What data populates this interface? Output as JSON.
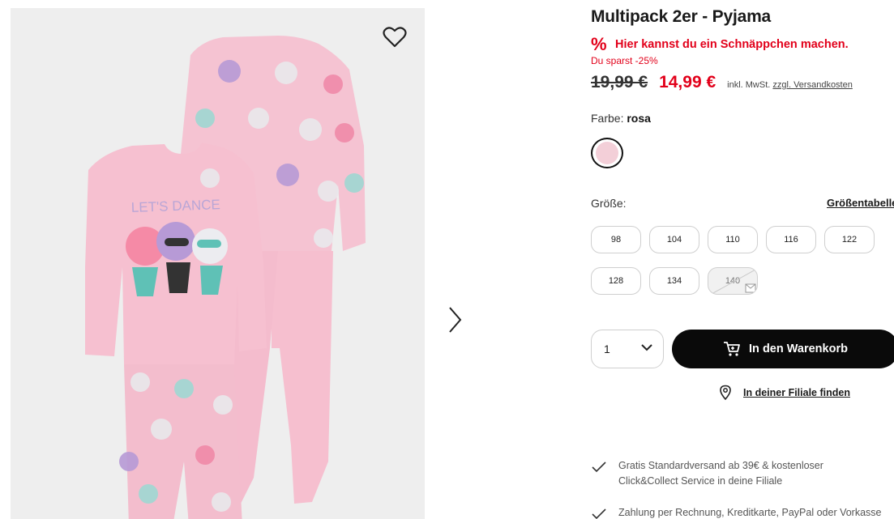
{
  "product": {
    "title": "Multipack 2er - Pyjama",
    "deal_icon": "%",
    "deal_text": "Hier kannst du ein Schnäppchen machen.",
    "savings": "Du sparst -25%",
    "old_price": "19,99 €",
    "new_price": "14,99 €",
    "vat_prefix": "inkl. MwSt.",
    "shipping_link": "zzgl. Versandkosten",
    "image_text": "LET'S DANCE"
  },
  "color": {
    "label": "Farbe:",
    "value": "rosa",
    "swatch_color": "#f3cfd8"
  },
  "size": {
    "label": "Größe:",
    "table_link": "Größentabelle",
    "options": [
      {
        "label": "98",
        "available": true
      },
      {
        "label": "104",
        "available": true
      },
      {
        "label": "110",
        "available": true
      },
      {
        "label": "116",
        "available": true
      },
      {
        "label": "122",
        "available": true
      },
      {
        "label": "128",
        "available": true
      },
      {
        "label": "134",
        "available": true
      },
      {
        "label": "140",
        "available": false
      }
    ]
  },
  "purchase": {
    "quantity": "1",
    "cart_label": "In den Warenkorb",
    "store_label": "In deiner Filiale finden"
  },
  "benefits": [
    {
      "line1": "Gratis Standardversand ab 39€ & kostenloser",
      "line2": "Click&Collect Service in deine Filiale"
    },
    {
      "line1": "Zahlung per Rechnung, Kreditkarte, PayPal oder Vorkasse",
      "line2": ""
    }
  ],
  "icons": {
    "favorite": "heart-icon",
    "next": "chevron-right-icon",
    "cart": "cart-icon",
    "store": "location-pin-icon",
    "check": "check-icon"
  },
  "colors": {
    "accent": "#e2001a",
    "button": "#0a0a0a",
    "pyjama_pink": "#f6c4d2",
    "gallery_bg": "#eeeeee"
  }
}
